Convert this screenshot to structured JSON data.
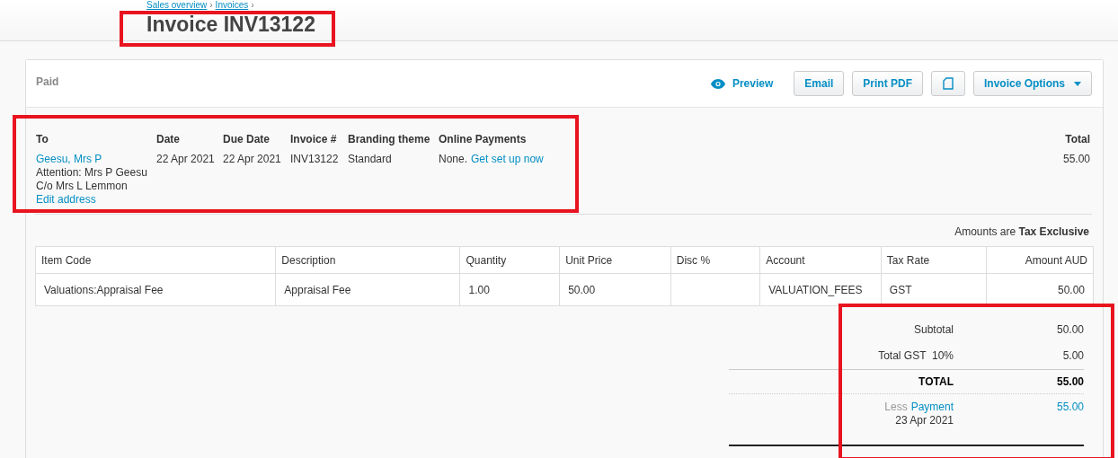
{
  "breadcrumb": {
    "items": [
      "Sales overview",
      "Invoices"
    ],
    "separator": "›"
  },
  "title": {
    "text": "Invoice INV13122",
    "highlighted": true
  },
  "status": "Paid",
  "actions": [
    {
      "kind": "link",
      "label": "Preview"
    },
    {
      "kind": "button",
      "label": "Email"
    },
    {
      "kind": "button",
      "label": "Print PDF"
    },
    {
      "kind": "icon"
    },
    {
      "kind": "dropdown",
      "label": "Invoice Options"
    }
  ],
  "details": {
    "highlighted": true,
    "to": {
      "heading": "To",
      "name": "Geesu, Mrs P",
      "lines": [
        "Attention: Mrs P Geesu",
        "C/o Mrs L Lemmon"
      ],
      "edit_link": "Edit address"
    },
    "fields": [
      {
        "heading": "Date",
        "value": "22 Apr 2021"
      },
      {
        "heading": "Due Date",
        "value": "22 Apr 2021"
      },
      {
        "heading": "Invoice #",
        "value": "INV13122"
      },
      {
        "heading": "Branding theme",
        "value": "Standard"
      }
    ],
    "online_payments": {
      "heading": "Online Payments",
      "value": "None.",
      "link": "Get set up now"
    },
    "total": {
      "heading": "Total",
      "value": "55.00"
    }
  },
  "tax_note": "Amounts are **Tax Exclusive**",
  "table": {
    "columns": [
      "Item Code",
      "Description",
      "Quantity",
      "Unit Price",
      "Disc %",
      "Account",
      "Tax Rate",
      "Amount AUD"
    ],
    "rows": [
      [
        "Valuations:Appraisal Fee",
        "Appraisal Fee",
        "1.00",
        "50.00",
        "",
        "VALUATION_FEES",
        "GST",
        "50.00"
      ]
    ]
  },
  "totals": {
    "highlighted": true,
    "lines": [
      {
        "kind": "plain",
        "label": "Subtotal",
        "value": "50.00"
      },
      {
        "kind": "plain",
        "label": "Total GST  10%",
        "value": "5.00"
      },
      {
        "kind": "grand",
        "label": "TOTAL",
        "value": "55.00"
      },
      {
        "kind": "payment",
        "prefix": "Less",
        "label": "Payment",
        "date": "23 Apr 2021",
        "value": "55.00"
      }
    ]
  }
}
